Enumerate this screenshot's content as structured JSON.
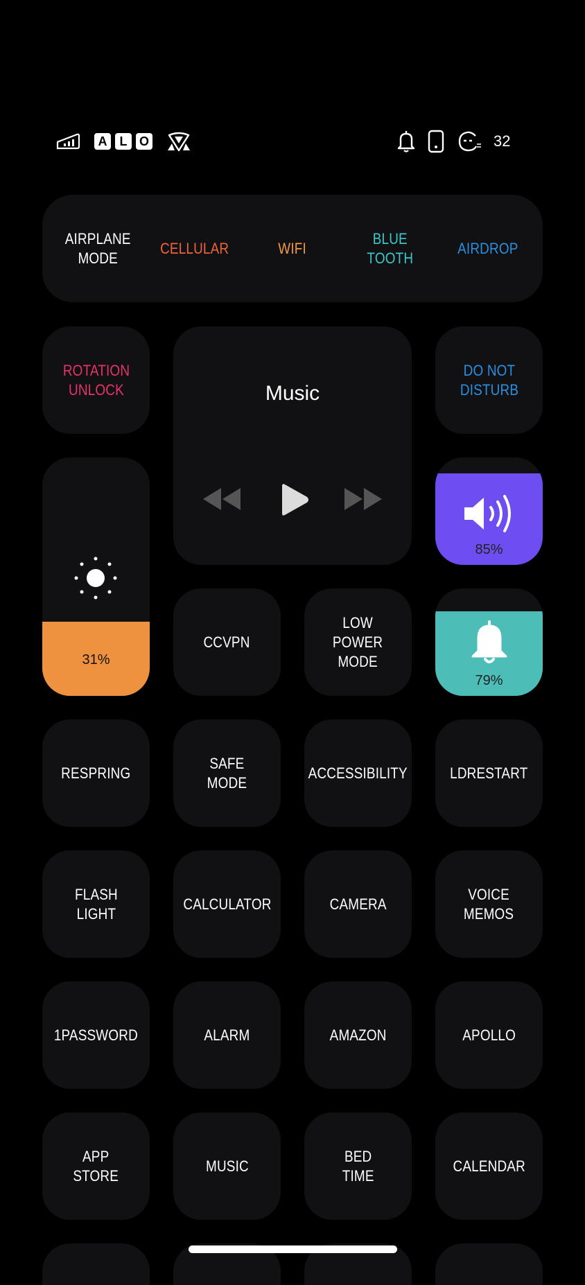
{
  "status_bar": {
    "carrier_letters": [
      "A",
      "L",
      "O"
    ],
    "battery_level": "32",
    "icons": [
      "signal-icon",
      "vpn-shield-icon",
      "bell-icon",
      "phone-icon",
      "face-icon"
    ]
  },
  "connectivity": [
    {
      "label": "AIRPLANE\nMODE",
      "color": "#ffffff"
    },
    {
      "label": "CELLULAR",
      "color": "#f0643c"
    },
    {
      "label": "WIFI",
      "color": "#f09a46"
    },
    {
      "label": "BLUE\nTOOTH",
      "color": "#3cc8c8"
    },
    {
      "label": "AIRDROP",
      "color": "#2a8fe0"
    }
  ],
  "rotation": {
    "label": "ROTATION\nUNLOCK",
    "color": "#e8336a"
  },
  "dnd": {
    "label": "DO NOT\nDISTURB",
    "color": "#2a8fe0"
  },
  "music_player": {
    "title": "Music"
  },
  "brightness": {
    "level": 0.31,
    "label": "31%",
    "color": "#ee9240"
  },
  "volume": {
    "level": 0.85,
    "label": "85%",
    "color": "#6e4ef0"
  },
  "ringer": {
    "level": 0.79,
    "label": "79%",
    "color": "#4dbdb8"
  },
  "row3": [
    {
      "label": "CCVPN"
    },
    {
      "label": "LOW\nPOWER\nMODE"
    }
  ],
  "grid": [
    {
      "label": "RESPRING"
    },
    {
      "label": "SAFE\nMODE"
    },
    {
      "label": "ACCESSIBILITY"
    },
    {
      "label": "LDRESTART"
    },
    {
      "label": "FLASH\nLIGHT"
    },
    {
      "label": "CALCULATOR"
    },
    {
      "label": "CAMERA"
    },
    {
      "label": "VOICE\nMEMOS"
    },
    {
      "label": "1PASSWORD"
    },
    {
      "label": "ALARM"
    },
    {
      "label": "AMAZON"
    },
    {
      "label": "APOLLO"
    },
    {
      "label": "APP\nSTORE"
    },
    {
      "label": "MUSIC"
    },
    {
      "label": "BED\nTIME"
    },
    {
      "label": "CALENDAR"
    }
  ]
}
